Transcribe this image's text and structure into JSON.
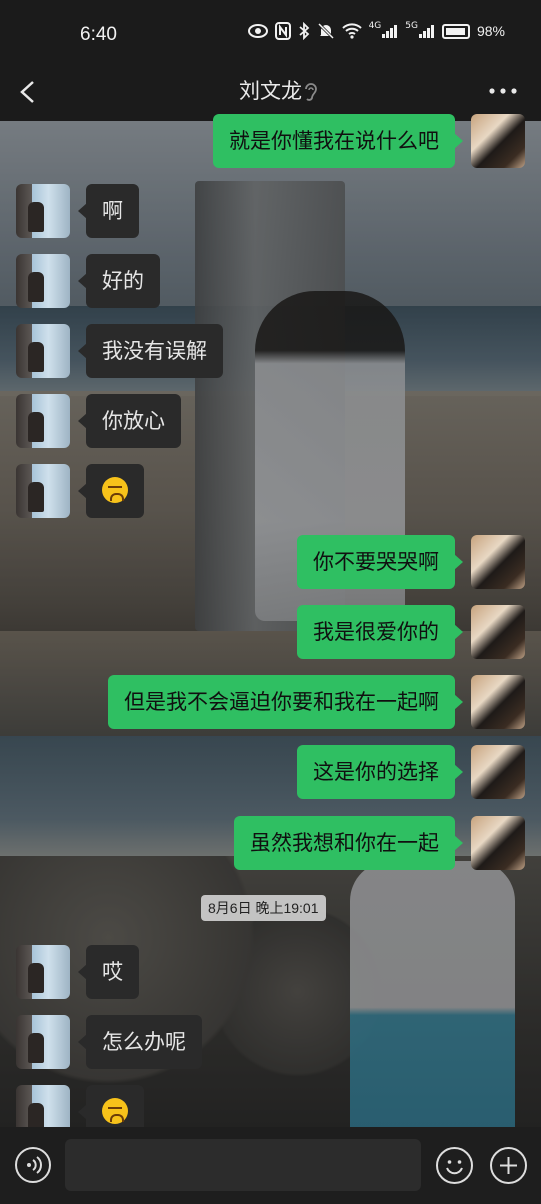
{
  "status_bar": {
    "time": "6:40",
    "network_4g": "4G",
    "network_5g": "5G",
    "battery": "98%"
  },
  "header": {
    "title": "刘文龙"
  },
  "messages": [
    {
      "from": "me",
      "text": "就是你懂我在说什么吧"
    },
    {
      "from": "other",
      "text": "啊"
    },
    {
      "from": "other",
      "text": "好的"
    },
    {
      "from": "other",
      "text": "我没有误解"
    },
    {
      "from": "other",
      "text": "你放心"
    },
    {
      "from": "other",
      "emoji": "grimace-emoji"
    },
    {
      "from": "me",
      "text": "你不要哭哭啊"
    },
    {
      "from": "me",
      "text": "我是很爱你的"
    },
    {
      "from": "me",
      "text": "但是我不会逼迫你要和我在一起啊"
    },
    {
      "from": "me",
      "text": "这是你的选择"
    },
    {
      "from": "me",
      "text": "虽然我想和你在一起"
    },
    {
      "from": "other",
      "text": "哎"
    },
    {
      "from": "other",
      "text": "怎么办呢"
    },
    {
      "from": "other",
      "emoji": "grimace-emoji"
    }
  ],
  "timestamp": "8月6日 晚上19:01",
  "input": {
    "value": ""
  },
  "colors": {
    "my_bubble": "#2fbf62",
    "other_bubble": "#2a2a2a",
    "bar_bg": "#1b1b1b"
  }
}
